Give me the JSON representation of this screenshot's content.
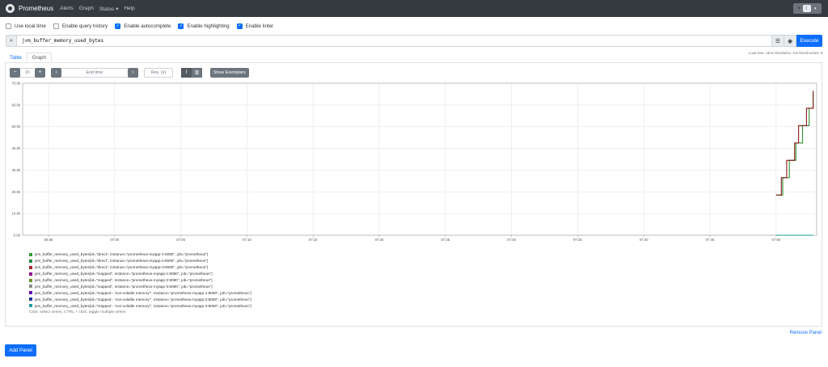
{
  "navbar": {
    "brand": "Prometheus",
    "links": [
      "Alerts",
      "Graph",
      "Status ▾",
      "Help"
    ]
  },
  "options": [
    {
      "label": "Use local time",
      "checked": false
    },
    {
      "label": "Enable query history",
      "checked": false
    },
    {
      "label": "Enable autocomplete",
      "checked": true
    },
    {
      "label": "Enable highlighting",
      "checked": true
    },
    {
      "label": "Enable linter",
      "checked": true
    }
  ],
  "query": {
    "expression": "jvm_buffer_memory_used_bytes",
    "execute_label": "Execute"
  },
  "stats": "Load time: 13ms   Resolution: 14s   Result series: 9",
  "tabs": [
    "Table",
    "Graph"
  ],
  "controls": {
    "range": "1h",
    "end_time_placeholder": "End time",
    "resolution_placeholder": "Res. (s)",
    "show_exemplars_label": "Show Exemplars"
  },
  "chart_data": {
    "type": "line",
    "x_ticks": [
      "06:55",
      "07:00",
      "07:05",
      "07:10",
      "07:15",
      "07:20",
      "07:25",
      "07:30",
      "07:35",
      "07:40",
      "07:45",
      "07:50"
    ],
    "y_ticks": [
      "0.00",
      "10.0k",
      "20.0k",
      "30.0k",
      "40.0k",
      "50.0k",
      "60.0k",
      "70.0k"
    ],
    "ylim": [
      0,
      70000
    ],
    "series": [
      {
        "color": "#2f8f2f",
        "points": [
          [
            "07:50",
            18500
          ],
          [
            "07:50.3",
            18500
          ],
          [
            "07:50.5",
            26500
          ],
          [
            "07:50.8",
            26500
          ],
          [
            "07:51",
            34500
          ],
          [
            "07:51.3",
            34500
          ],
          [
            "07:51.5",
            42500
          ],
          [
            "07:51.8",
            42500
          ],
          [
            "07:52",
            50500
          ],
          [
            "07:52.3",
            50500
          ],
          [
            "07:52.5",
            58500
          ],
          [
            "07:52.8",
            66500
          ]
        ]
      },
      {
        "color": "#8b1a1a",
        "points": [
          [
            "07:50",
            18500
          ],
          [
            "07:50.3",
            18500
          ],
          [
            "07:50.4",
            26500
          ],
          [
            "07:50.7",
            26500
          ],
          [
            "07:50.8",
            34500
          ],
          [
            "07:51.2",
            34500
          ],
          [
            "07:51.4",
            42500
          ],
          [
            "07:51.7",
            50500
          ],
          [
            "07:52",
            50500
          ],
          [
            "07:52.3",
            58500
          ],
          [
            "07:52.5",
            58500
          ],
          [
            "07:52.8",
            66500
          ]
        ]
      },
      {
        "color": "#1b9e9e",
        "points": [
          [
            "07:50",
            0
          ],
          [
            "07:52.8",
            0
          ]
        ]
      }
    ]
  },
  "legend": {
    "items": [
      {
        "color": "#2ca02c",
        "metric": "jvm_buffer_memory_used_bytes",
        "labels": "{id=\"direct\", instance=\"prometheus-myapp-1:8080\", job=\"prometheus\"}"
      },
      {
        "color": "#238b45",
        "metric": "jvm_buffer_memory_used_bytes",
        "labels": "{id=\"direct\", instance=\"prometheus-myapp-2:8080\", job=\"prometheus\"}"
      },
      {
        "color": "#a52a2a",
        "metric": "jvm_buffer_memory_used_bytes",
        "labels": "{id=\"direct\", instance=\"prometheus-myapp-3:8080\", job=\"prometheus\"}"
      },
      {
        "color": "#8b008b",
        "metric": "jvm_buffer_memory_used_bytes",
        "labels": "{id=\"mapped\", instance=\"prometheus-myapp-1:8080\", job=\"prometheus\"}"
      },
      {
        "color": "#6b8e23",
        "metric": "jvm_buffer_memory_used_bytes",
        "labels": "{id=\"mapped\", instance=\"prometheus-myapp-2:8080\", job=\"prometheus\"}"
      },
      {
        "color": "#8c8c8c",
        "metric": "jvm_buffer_memory_used_bytes",
        "labels": "{id=\"mapped\", instance=\"prometheus-myapp-3:8080\", job=\"prometheus\"}"
      },
      {
        "color": "#6a0dad",
        "metric": "jvm_buffer_memory_used_bytes",
        "labels": "{id=\"mapped - 'non-volatile memory'\", instance=\"prometheus-myapp-1:8080\", job=\"prometheus\"}"
      },
      {
        "color": "#1f3a93",
        "metric": "jvm_buffer_memory_used_bytes",
        "labels": "{id=\"mapped - 'non-volatile memory'\", instance=\"prometheus-myapp-2:8080\", job=\"prometheus\"}"
      },
      {
        "color": "#20a39e",
        "metric": "jvm_buffer_memory_used_bytes",
        "labels": "{id=\"mapped - 'non-volatile memory'\", instance=\"prometheus-myapp-3:8080\", job=\"prometheus\"}"
      }
    ],
    "hint": "Click: select series, CTRL + click: toggle multiple series"
  },
  "remove_panel_label": "Remove Panel",
  "add_panel_label": "Add Panel"
}
